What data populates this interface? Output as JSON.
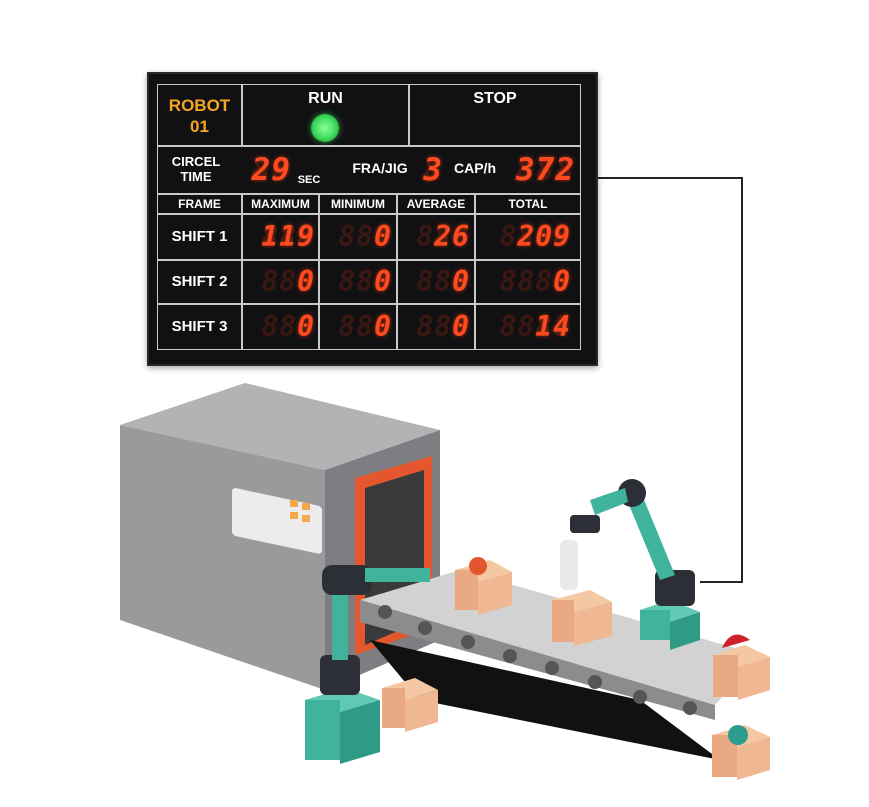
{
  "board": {
    "robot_label": "ROBOT",
    "robot_number": "01",
    "run_label": "RUN",
    "stop_label": "STOP",
    "cycle_label_1": "CIRCEL",
    "cycle_label_2": "TIME",
    "cycle_value": "29",
    "cycle_unit": "SEC",
    "fra_jig_label": "FRA/JIG",
    "fra_jig_value": "3",
    "cap_label": "CAP/h",
    "cap_value": "372",
    "columns": [
      "FRAME",
      "MAXIMUM",
      "MINIMUM",
      "AVERAGE",
      "TOTAL"
    ],
    "rows": [
      {
        "label": "SHIFT 1",
        "maximum": "119",
        "minimum": "0",
        "average": "26",
        "total": "209"
      },
      {
        "label": "SHIFT 2",
        "maximum": "0",
        "minimum": "0",
        "average": "0",
        "total": "0"
      },
      {
        "label": "SHIFT 3",
        "maximum": "0",
        "minimum": "0",
        "average": "0",
        "total": "14"
      }
    ],
    "colors": {
      "background": "#111113",
      "segment_on": "#ff4a20",
      "robot_label": "#f5a623",
      "run_led": "#3ddc5a"
    }
  }
}
